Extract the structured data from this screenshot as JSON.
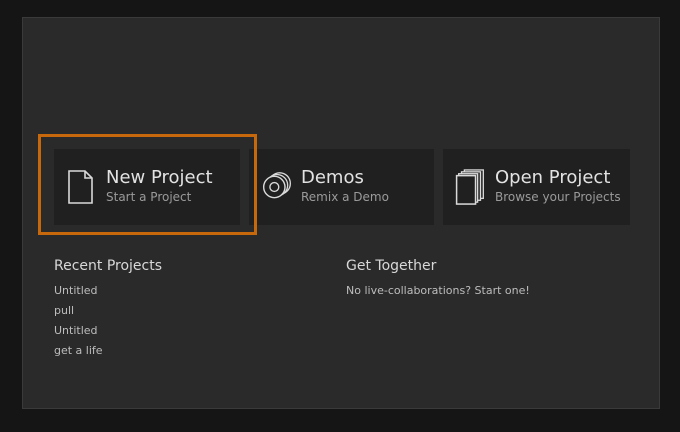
{
  "actions": {
    "new_project": {
      "title": "New Project",
      "subtitle": "Start a Project",
      "icon": "document-icon"
    },
    "demos": {
      "title": "Demos",
      "subtitle": "Remix a Demo",
      "icon": "discs-icon"
    },
    "open_project": {
      "title": "Open Project",
      "subtitle": "Browse your Projects",
      "icon": "stacked-pages-icon"
    }
  },
  "recent_projects": {
    "title": "Recent Projects",
    "items": [
      "Untitled",
      "pull",
      "Untitled",
      "get a life"
    ]
  },
  "get_together": {
    "title": "Get Together",
    "text": "No live-collaborations? Start one!"
  },
  "colors": {
    "background": "#151515",
    "dialog": "#2a2a2a",
    "card": "#202020",
    "highlight": "#c8680c"
  }
}
